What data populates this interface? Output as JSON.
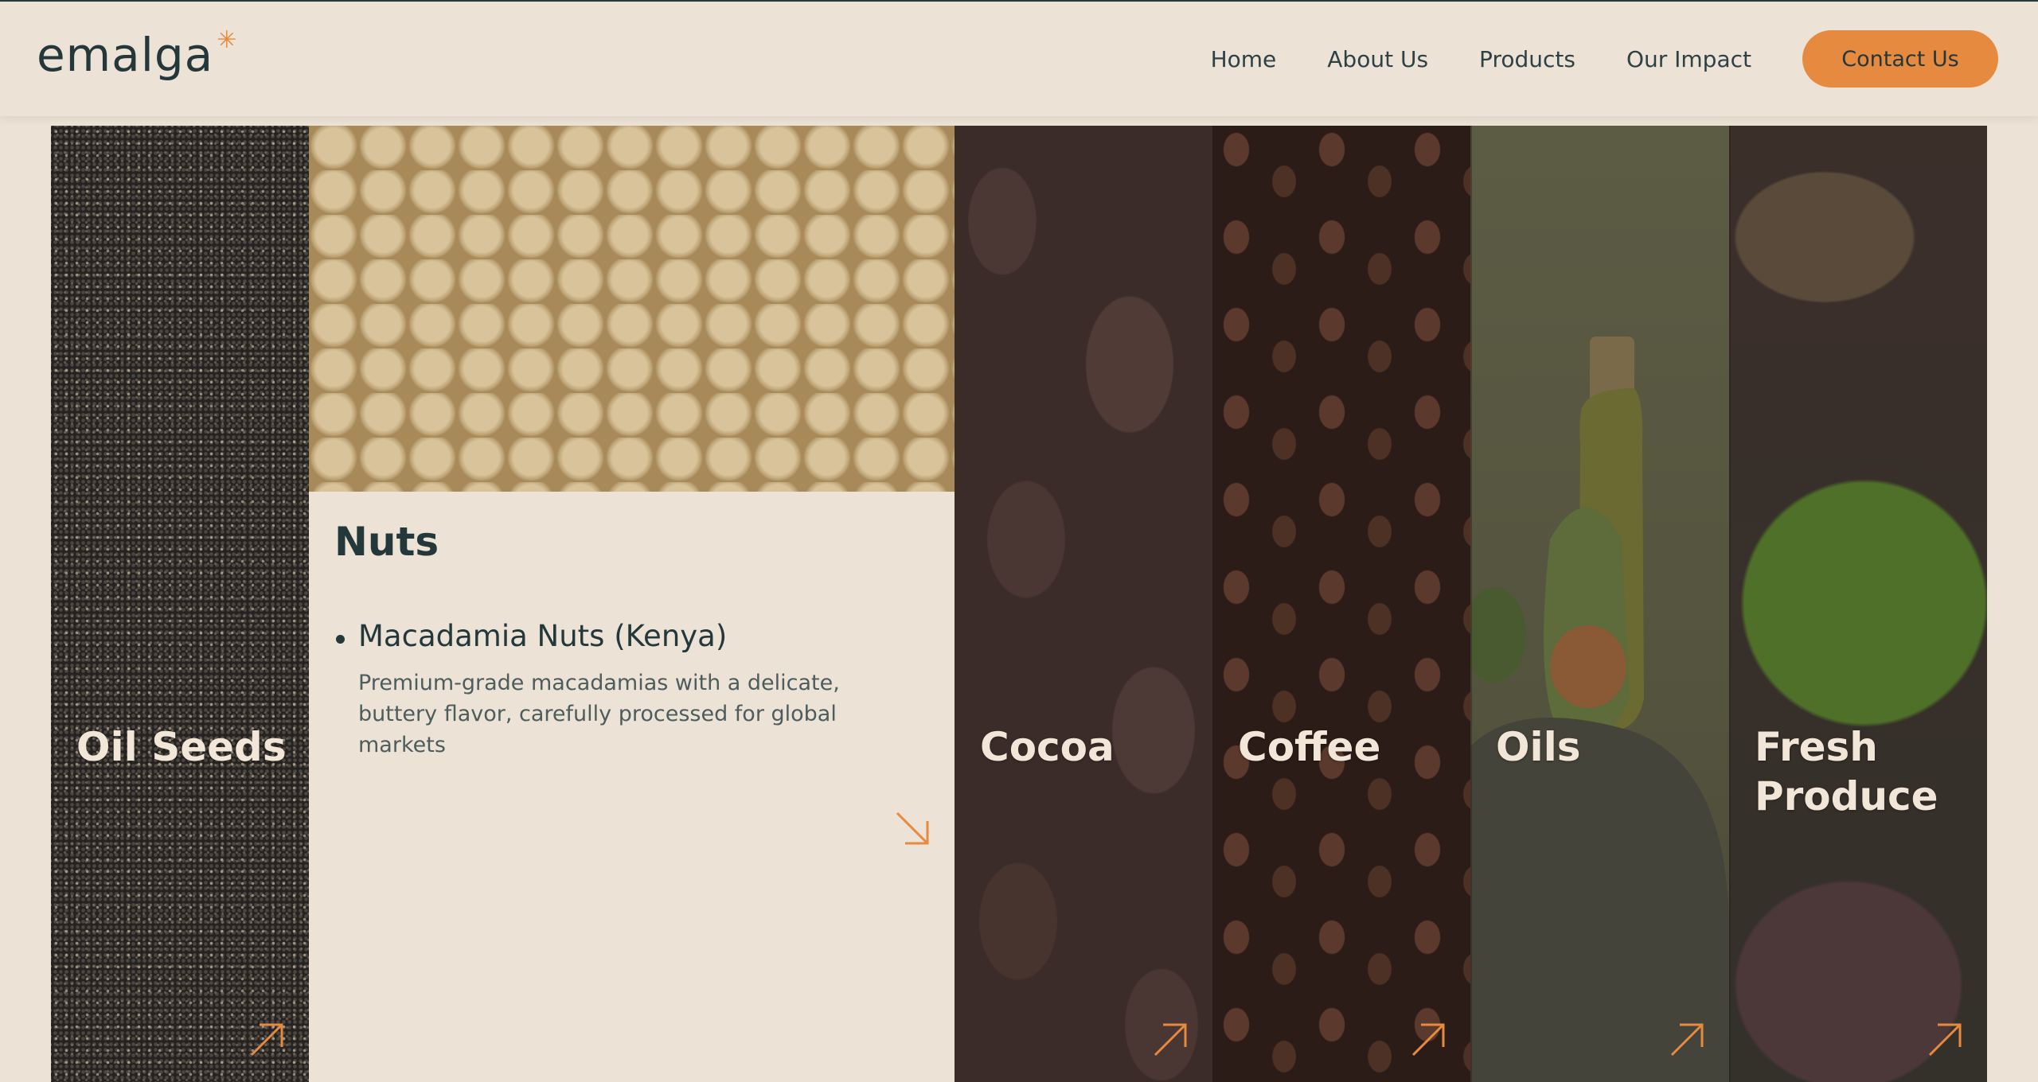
{
  "header": {
    "logo": "emalga",
    "logo_mark": "*",
    "nav": [
      "Home",
      "About Us",
      "Products",
      "Our Impact"
    ],
    "cta": "Contact Us"
  },
  "colors": {
    "accent": "#e58a3e",
    "background": "#ece3d6",
    "text": "#24383b"
  },
  "categories": [
    {
      "name": "Oil Seeds",
      "image": "chia-seeds"
    },
    {
      "name": "Nuts",
      "image": "macadamia-nuts",
      "expanded": true
    },
    {
      "name": "Cocoa",
      "image": "cocoa-beans"
    },
    {
      "name": "Coffee",
      "image": "coffee-beans"
    },
    {
      "name": "Oils",
      "image": "oil-bottle-avocado"
    },
    {
      "name": "Fresh Produce",
      "image": "avocados"
    }
  ],
  "expanded": {
    "title": "Nuts",
    "items": [
      {
        "name": "Macadamia Nuts (Kenya)",
        "description": "Premium-grade macadamias with a delicate, buttery flavor, carefully processed for global markets"
      }
    ]
  },
  "icons": {
    "collapsed_arrow": "arrow-up-right-icon",
    "expanded_arrow": "arrow-down-right-icon"
  }
}
